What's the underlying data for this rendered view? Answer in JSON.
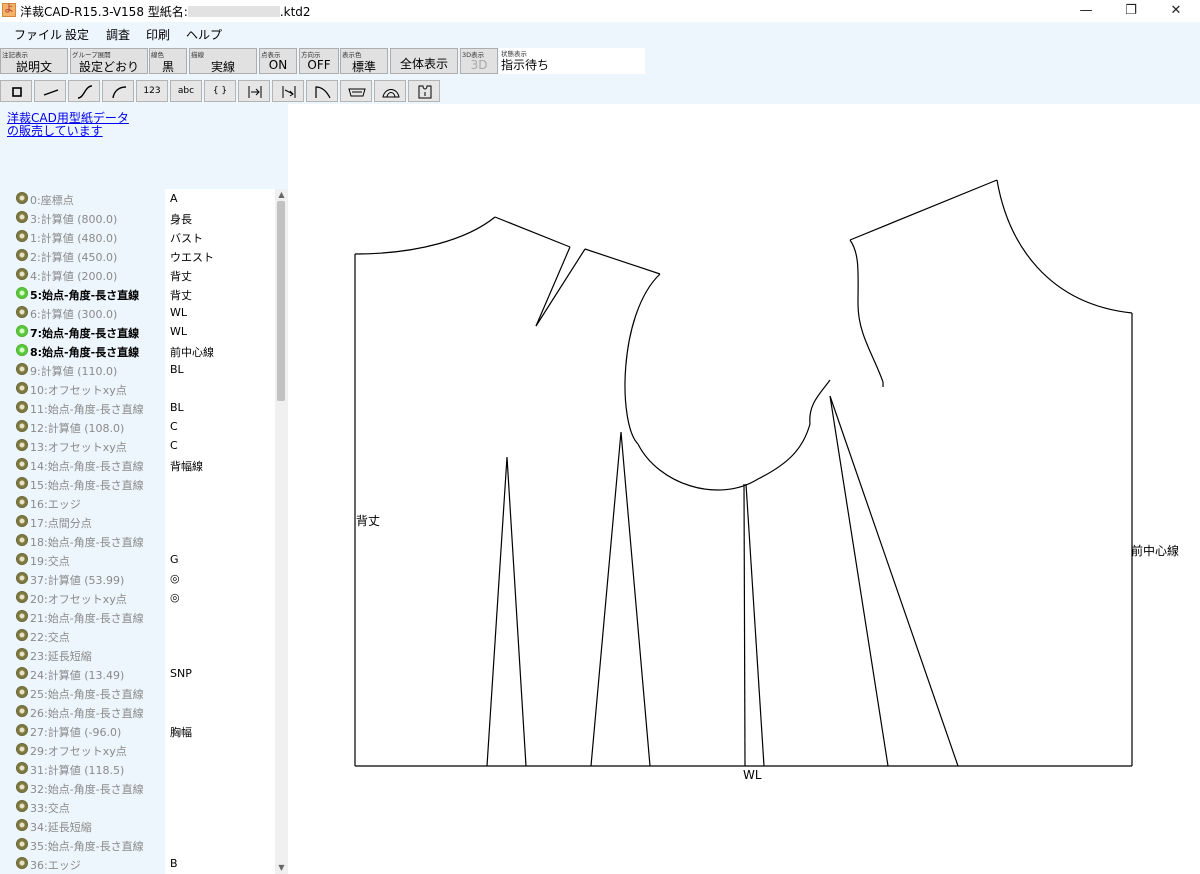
{
  "window": {
    "title_prefix": "洋裁CAD-R15.3-V158 型紙名:",
    "title_suffix": ".ktd2",
    "app_icon_glyph": "よ",
    "minimize": "—",
    "restore": "❐",
    "close": "✕"
  },
  "menu": [
    "ファイル",
    "設定",
    "調査",
    "印刷",
    "ヘルプ"
  ],
  "toolbar": {
    "buttons": [
      {
        "small": "注記表示",
        "big": "説明文"
      },
      {
        "small": "グループ展開",
        "big": "設定どおり"
      },
      {
        "small": "線色",
        "big": "黒"
      },
      {
        "small": "描線",
        "big": "実線"
      },
      {
        "small": "点表示",
        "big": "ON"
      },
      {
        "small": "方向示",
        "big": "OFF"
      },
      {
        "small": "表示色",
        "big": "標準"
      },
      {
        "small": "",
        "big": "全体表示"
      },
      {
        "small": "3D表示",
        "big": "3D"
      }
    ],
    "status_small": "状態表示",
    "status_big": "指示待ち"
  },
  "tools": [
    {
      "icon": "rectangle-icon"
    },
    {
      "icon": "line-icon"
    },
    {
      "icon": "s-curve-icon"
    },
    {
      "icon": "arc-icon"
    },
    {
      "icon": "number-icon",
      "label": "123"
    },
    {
      "icon": "text-icon",
      "label": "abc"
    },
    {
      "icon": "braces-icon",
      "label": "{ }"
    },
    {
      "icon": "offset-right-icon"
    },
    {
      "icon": "offset-left-icon"
    },
    {
      "icon": "corner-curve-icon"
    },
    {
      "icon": "trapezoid-icon"
    },
    {
      "icon": "dome-icon"
    },
    {
      "icon": "pattern-piece-icon"
    }
  ],
  "promo": {
    "line1": "洋裁CAD用型紙データ",
    "line2": "の販売しています"
  },
  "items": [
    {
      "name": "0:座標点",
      "tag": "A",
      "active": false
    },
    {
      "name": "3:計算値 (800.0)",
      "tag": "身長",
      "active": false
    },
    {
      "name": "1:計算値 (480.0)",
      "tag": "バスト",
      "active": false
    },
    {
      "name": "2:計算値 (450.0)",
      "tag": "ウエスト",
      "active": false
    },
    {
      "name": "4:計算値 (200.0)",
      "tag": "背丈",
      "active": false
    },
    {
      "name": "5:始点-角度-長さ直線",
      "tag": "背丈",
      "active": true
    },
    {
      "name": "6:計算値 (300.0)",
      "tag": "WL",
      "active": false
    },
    {
      "name": "7:始点-角度-長さ直線",
      "tag": "WL",
      "active": true
    },
    {
      "name": "8:始点-角度-長さ直線",
      "tag": "前中心線",
      "active": true
    },
    {
      "name": "9:計算値 (110.0)",
      "tag": "BL",
      "active": false
    },
    {
      "name": "10:オフセットxy点",
      "tag": "",
      "active": false
    },
    {
      "name": "11:始点-角度-長さ直線",
      "tag": "BL",
      "active": false
    },
    {
      "name": "12:計算値 (108.0)",
      "tag": "C",
      "active": false
    },
    {
      "name": "13:オフセットxy点",
      "tag": "C",
      "active": false
    },
    {
      "name": "14:始点-角度-長さ直線",
      "tag": "背幅線",
      "active": false
    },
    {
      "name": "15:始点-角度-長さ直線",
      "tag": "",
      "active": false
    },
    {
      "name": "16:エッジ",
      "tag": "",
      "active": false
    },
    {
      "name": "17:点間分点",
      "tag": "",
      "active": false
    },
    {
      "name": "18:始点-角度-長さ直線",
      "tag": "",
      "active": false
    },
    {
      "name": "19:交点",
      "tag": "G",
      "active": false
    },
    {
      "name": "37:計算値 (53.99)",
      "tag": "◎",
      "active": false
    },
    {
      "name": "20:オフセットxy点",
      "tag": "◎",
      "active": false
    },
    {
      "name": "21:始点-角度-長さ直線",
      "tag": "",
      "active": false
    },
    {
      "name": "22:交点",
      "tag": "",
      "active": false
    },
    {
      "name": "23:延長短縮",
      "tag": "",
      "active": false
    },
    {
      "name": "24:計算値 (13.49)",
      "tag": "SNP",
      "active": false
    },
    {
      "name": "25:始点-角度-長さ直線",
      "tag": "",
      "active": false
    },
    {
      "name": "26:始点-角度-長さ直線",
      "tag": "",
      "active": false
    },
    {
      "name": "27:計算値 (-96.0)",
      "tag": "胸幅",
      "active": false
    },
    {
      "name": "29:オフセットxy点",
      "tag": "",
      "active": false
    },
    {
      "name": "31:計算値 (118.5)",
      "tag": "",
      "active": false
    },
    {
      "name": "32:始点-角度-長さ直線",
      "tag": "",
      "active": false
    },
    {
      "name": "33:交点",
      "tag": "",
      "active": false
    },
    {
      "name": "34:延長短縮",
      "tag": "",
      "active": false
    },
    {
      "name": "35:始点-角度-長さ直線",
      "tag": "",
      "active": false
    },
    {
      "name": "36:エッジ",
      "tag": "B",
      "active": false
    }
  ],
  "canvas_labels": {
    "back_length": "背丈",
    "front_center": "前中心線",
    "waist_line": "WL"
  }
}
